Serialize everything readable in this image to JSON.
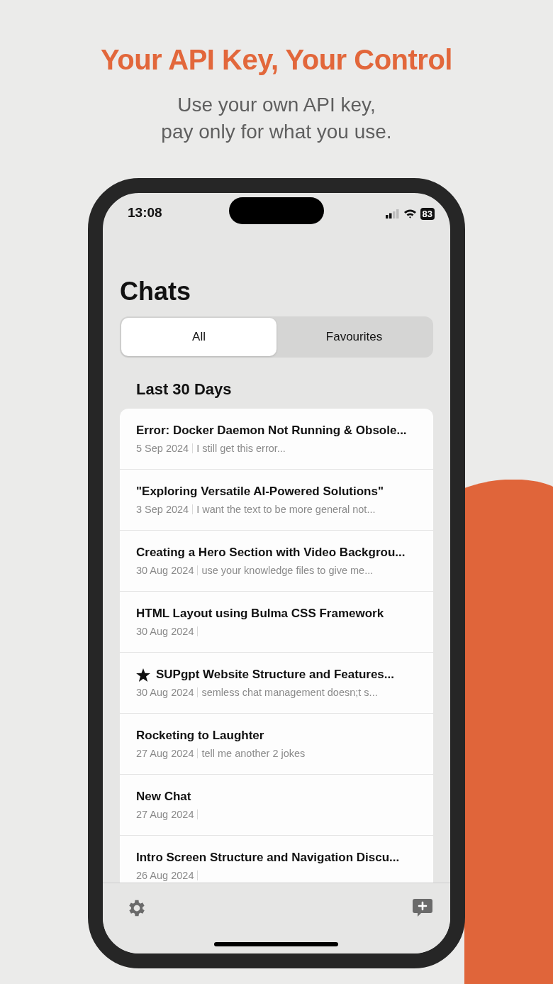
{
  "headline": "Your API Key, Your Control",
  "subtitle": "Use your own API key,\npay only for what you use.",
  "status_bar": {
    "time": "13:08",
    "battery": "83"
  },
  "title": "Chats",
  "tabs": [
    {
      "label": "All",
      "selected": true
    },
    {
      "label": "Favourites",
      "selected": false
    }
  ],
  "section": "Last 30 Days",
  "chats": [
    {
      "title": "Error: Docker Daemon Not Running & Obsole...",
      "date": "5 Sep 2024",
      "preview": "I still get this error...",
      "starred": false
    },
    {
      "title": "\"Exploring Versatile AI-Powered Solutions\"",
      "date": "3 Sep 2024",
      "preview": "I want the text to be more general not...",
      "starred": false
    },
    {
      "title": "Creating a Hero Section with Video Backgrou...",
      "date": "30 Aug 2024",
      "preview": "use your knowledge files to give me...",
      "starred": false
    },
    {
      "title": "HTML Layout using Bulma CSS Framework",
      "date": "30 Aug 2024",
      "starred": false
    },
    {
      "title": "SUPgpt Website Structure and Features...",
      "date": "30 Aug 2024",
      "preview": "semless chat management doesn;t s...",
      "starred": true
    },
    {
      "title": "Rocketing to Laughter",
      "date": "27 Aug 2024",
      "preview": "tell me another 2 jokes",
      "starred": false
    },
    {
      "title": "New Chat",
      "date": "27 Aug 2024",
      "starred": false
    },
    {
      "title": "Intro Screen Structure and Navigation Discu...",
      "date": "26 Aug 2024",
      "starred": false
    }
  ]
}
